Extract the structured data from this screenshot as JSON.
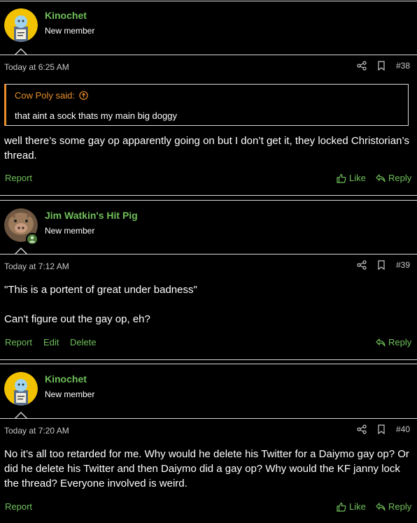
{
  "posts": [
    {
      "username": "Kinochet",
      "user_title": "New member",
      "timestamp": "Today at 6:25 AM",
      "post_number": "#38",
      "quote": {
        "author": "Cow Poly said:",
        "text": "that aint a sock thats my main big doggy"
      },
      "body": [
        "well there’s some gay op apparently going on but I don’t get it, they locked Christorian’s thread."
      ],
      "actions": [
        "Report"
      ],
      "reactions": {
        "like": "Like",
        "reply": "Reply"
      }
    },
    {
      "username": "Jim Watkin's Hit Pig",
      "user_title": "New member",
      "timestamp": "Today at 7:12 AM",
      "post_number": "#39",
      "body": [
        "\"This is a portent of great under badness\"",
        "Can't figure out the gay op, eh?"
      ],
      "actions": [
        "Report",
        "Edit",
        "Delete"
      ],
      "reactions": {
        "reply": "Reply"
      }
    },
    {
      "username": "Kinochet",
      "user_title": "New member",
      "timestamp": "Today at 7:20 AM",
      "post_number": "#40",
      "body": [
        "No it’s all too retarded for me. Why would he delete his Twitter for a Daiymo gay op? Or did he delete his Twitter and then Daiymo did a gay op? Why would the KF janny lock the thread? Everyone involved is weird."
      ],
      "actions": [
        "Report"
      ],
      "reactions": {
        "like": "Like",
        "reply": "Reply"
      }
    }
  ],
  "colors": {
    "username": "#6fbf5a",
    "link": "#6fbf5a",
    "quote_accent": "#e88d2b",
    "divider": "#d8d8d8",
    "background": "#000000"
  },
  "icons": {
    "share": "share-icon",
    "bookmark": "bookmark-icon",
    "like": "thumbs-up-icon",
    "reply": "reply-arrow-icon",
    "quote_jump": "circle-arrow-up-icon",
    "online": "online-user-icon"
  }
}
